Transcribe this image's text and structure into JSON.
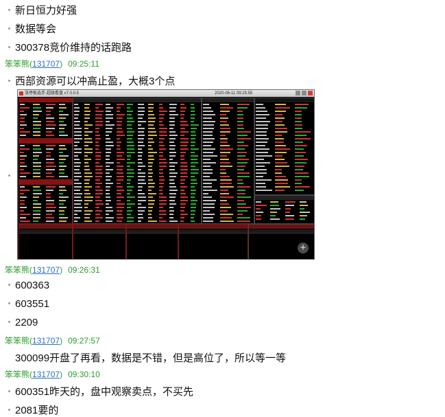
{
  "messages_top": [
    "新日恒力好强",
    "数据等会",
    "300378竞价维持的话跑路"
  ],
  "posts": [
    {
      "sender": "笨笨熊",
      "uid": "131707",
      "time": "09:25:11"
    },
    {
      "sender": "笨笨熊",
      "uid": "131707",
      "time": "09:26:31"
    },
    {
      "sender": "笨笨熊",
      "uid": "131707",
      "time": "09:27:57"
    },
    {
      "sender": "笨笨熊",
      "uid": "131707",
      "time": "09:30:10"
    }
  ],
  "post1_text": "西部资源可以冲高止盈，大概3个点",
  "post2_lines": [
    "600363",
    "603551",
    "2209"
  ],
  "post3_text": "300099开盘了再看，数据是不错，但是高位了，所以等一等",
  "post4_lines": [
    "600351昨天的，盘中观察卖点，不买先",
    "2081要的"
  ],
  "screenshot": {
    "title": "涨停板选手-超级看盘 v7.0.0.5",
    "datetime": "2020-06-11 09:25:55"
  },
  "colors": {
    "sender": "#2c9d2c",
    "uid": "#2c6fbf",
    "up": "#ff3b3b",
    "down": "#2bd12b",
    "flat": "#e8e8e8"
  }
}
